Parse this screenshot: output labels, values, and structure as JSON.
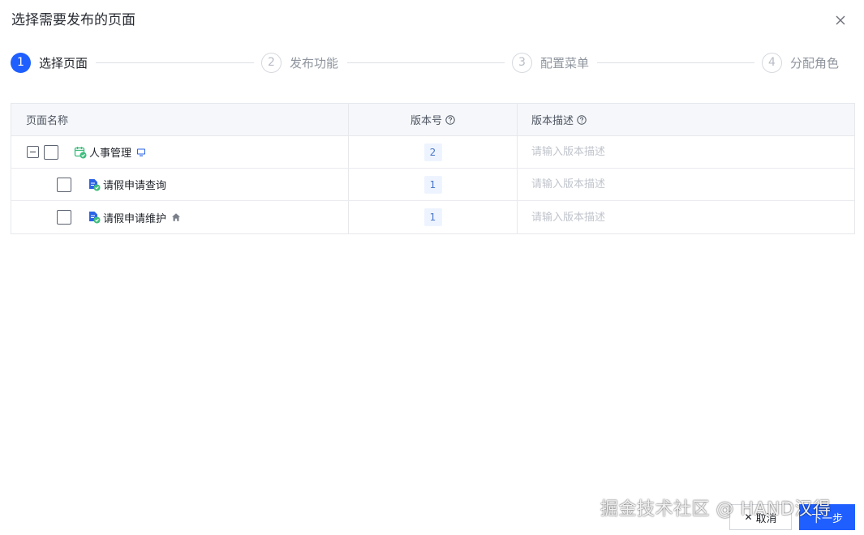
{
  "dialog": {
    "title": "选择需要发布的页面"
  },
  "steps": [
    {
      "number": "1",
      "label": "选择页面",
      "state": "active"
    },
    {
      "number": "2",
      "label": "发布功能",
      "state": "todo"
    },
    {
      "number": "3",
      "label": "配置菜单",
      "state": "todo"
    },
    {
      "number": "4",
      "label": "分配角色",
      "state": "todo"
    }
  ],
  "table": {
    "headers": {
      "name": "页面名称",
      "version": "版本号",
      "description": "版本描述"
    },
    "rows": [
      {
        "name": "人事管理",
        "version": "2",
        "description_placeholder": "请输入版本描述",
        "icon": "calendar-check-icon",
        "tag_icon": "desktop-icon",
        "expanded": true,
        "checked": false
      },
      {
        "name": "请假申请查询",
        "version": "1",
        "description_placeholder": "请输入版本描述",
        "icon": "document-check-icon",
        "tag_icon": "",
        "checked": false
      },
      {
        "name": "请假申请维护",
        "version": "1",
        "description_placeholder": "请输入版本描述",
        "icon": "document-check-icon",
        "tag_icon": "home-icon",
        "checked": false
      }
    ]
  },
  "footer": {
    "cancel_label": "取消",
    "next_label": "下一步"
  },
  "watermark": "掘金技术社区 @ HAND汉得",
  "colors": {
    "primary": "#1f5fff",
    "success": "#3dbd7d"
  }
}
